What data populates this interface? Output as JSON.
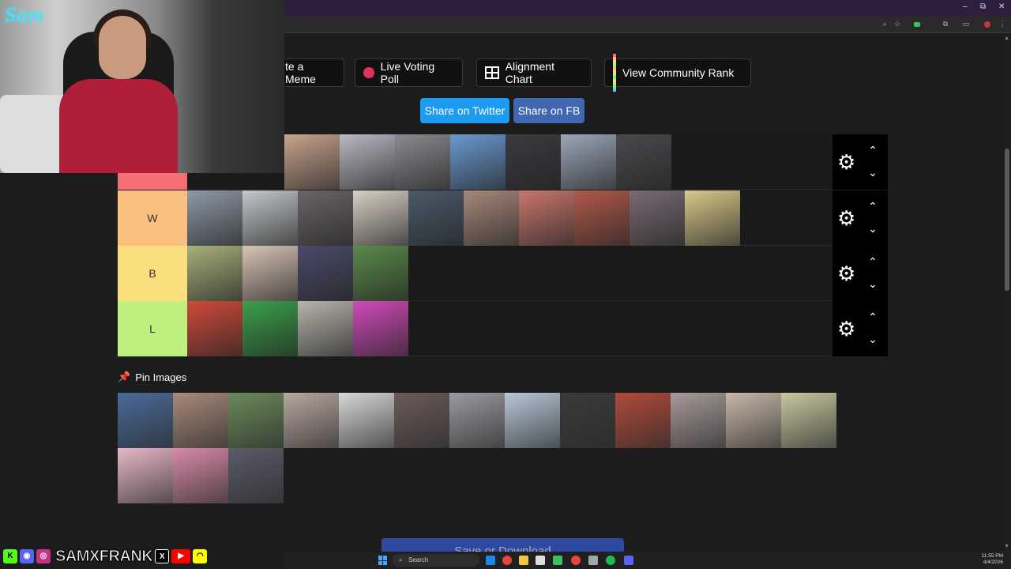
{
  "browser": {
    "window_controls": [
      "–",
      "⧉",
      "✕"
    ]
  },
  "actions": {
    "create_meme": "te a Meme",
    "live_voting": "Live Voting Poll",
    "alignment_chart": "Alignment Chart",
    "community_rank": "View Community Rank"
  },
  "share": {
    "twitter": "Share on Twitter",
    "facebook": "Share on FB"
  },
  "tiers": [
    {
      "label": "",
      "color": "#f36f74",
      "items": 7
    },
    {
      "label": "W",
      "color": "#fbbf7f",
      "items": 10
    },
    {
      "label": "B",
      "color": "#fbdf7f",
      "items": 4
    },
    {
      "label": "L",
      "color": "#bff07f",
      "items": 4
    }
  ],
  "pin": {
    "title": "Pin Images",
    "count": 16
  },
  "save_button": "Save or Download",
  "webcam": {
    "logo": "Sam"
  },
  "social": {
    "handle": "SAMXFRANK",
    "icons": [
      "kick-icon",
      "discord-icon",
      "instagram-icon",
      "x-icon",
      "youtube-icon",
      "snapchat-icon"
    ]
  },
  "taskbar": {
    "search_placeholder": "Search",
    "time": "11:55 PM",
    "date": "4/4/2026"
  },
  "colors": {
    "twitter": "#1d9bf0",
    "facebook": "#4267b2",
    "record": "#e0325a"
  }
}
